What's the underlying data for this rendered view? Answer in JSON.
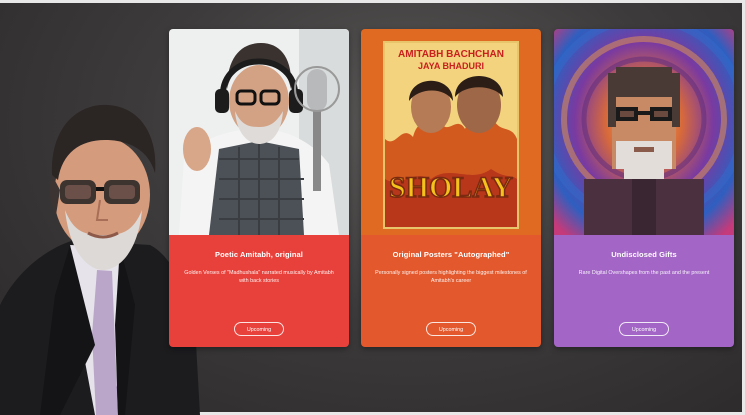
{
  "cards": [
    {
      "title": "Poetic Amitabh, original",
      "description": "Golden Verses of \"Madhushala\" narrated musically by Amitabh with back stories",
      "button_label": "Upcoming",
      "info_color": "#e8413b"
    },
    {
      "title": "Original Posters \"Autographed\"",
      "description": "Personally signed posters highlighting the biggest milestones of Amitabh's career",
      "button_label": "Upcoming",
      "info_color": "#e3582c",
      "poster_text": {
        "top_line": "AMITABH BACHCHAN",
        "second_line": "JAYA BHADURI",
        "logo": "SHOLAY"
      }
    },
    {
      "title": "Undisclosed Gifts",
      "description": "Rare Digital Overshapes from the past and the present",
      "button_label": "Upcoming",
      "info_color": "#a365c6"
    }
  ],
  "colors": {
    "background": "#3d3b3b",
    "card1_top": "#eef0f0",
    "card2_top": "#e06a22",
    "card3_top": "#c9783d"
  }
}
